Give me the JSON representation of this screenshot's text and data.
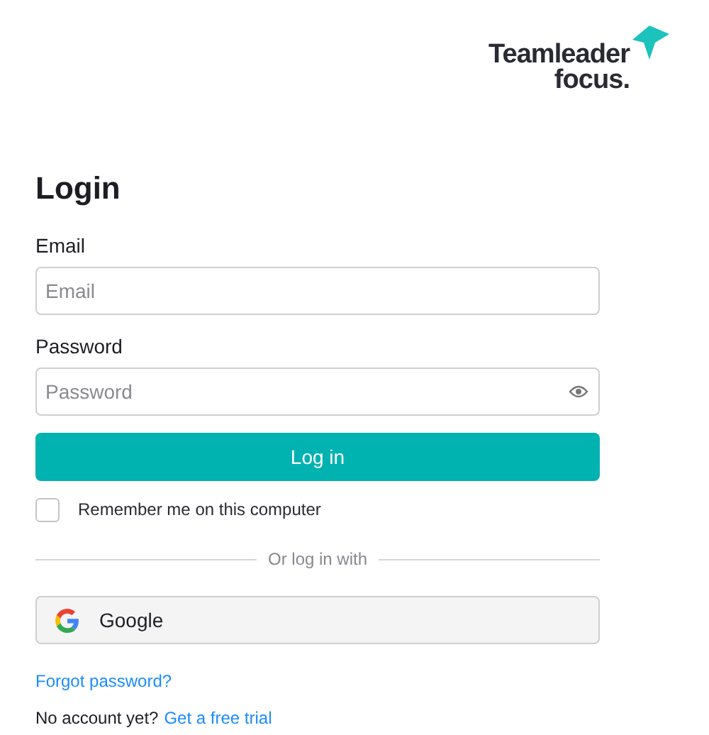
{
  "logo": {
    "line_1": "Teamleader",
    "line_2": "focus."
  },
  "title": "Login",
  "fields": [
    {
      "label": "Email",
      "placeholder": "Email",
      "kind": "text"
    },
    {
      "label": "Password",
      "placeholder": "Password",
      "kind": "password"
    }
  ],
  "login_button": "Log in",
  "remember": {
    "label": "Remember me on this computer",
    "checked": false
  },
  "divider": "Or log in with",
  "google_button": "Google",
  "forgot_link": "Forgot password?",
  "signup": {
    "text": "No account yet?",
    "link": "Get a free trial"
  }
}
